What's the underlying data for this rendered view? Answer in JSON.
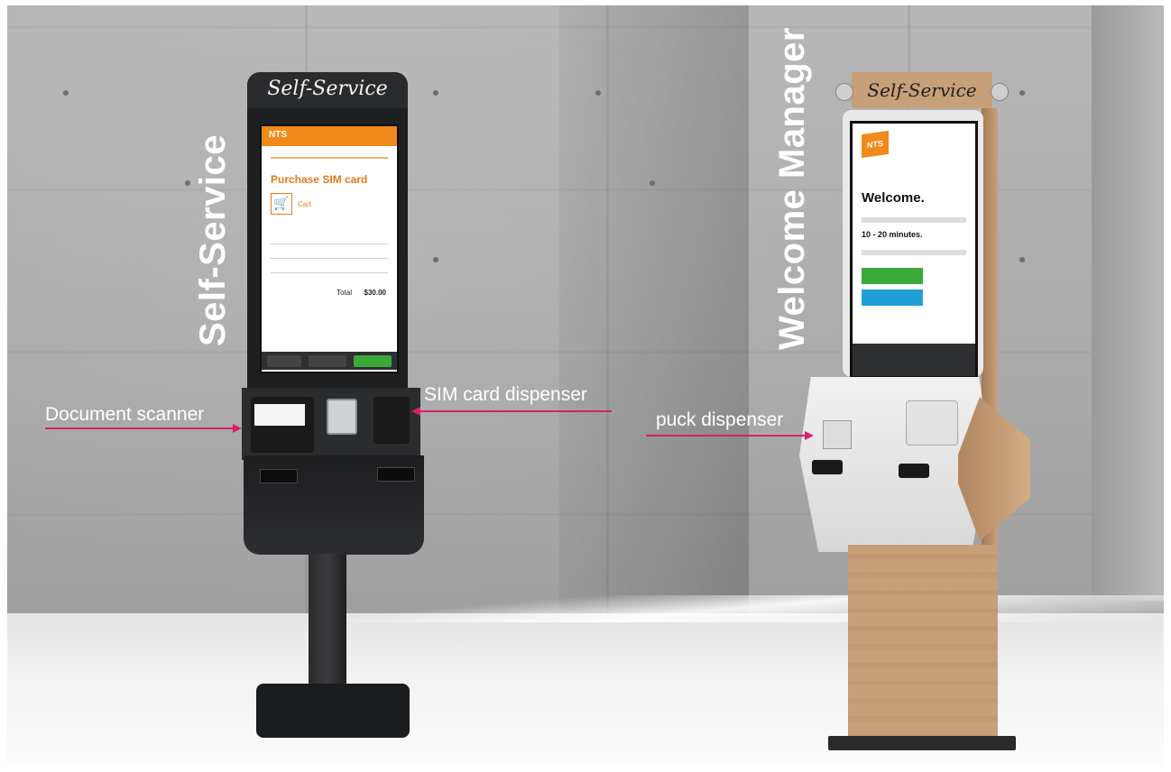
{
  "image": {
    "left_label": "Self-Service",
    "right_label": "Welcome Manager",
    "callouts": {
      "document_scanner": "Document scanner",
      "sim_card_dispenser": "SIM card dispenser",
      "puck_dispenser": "puck dispenser"
    },
    "colors": {
      "callout_arrow": "#d8206a",
      "kiosk_accent": "#f08a1a"
    }
  },
  "left_kiosk": {
    "header_sign": "Self-Service",
    "screen": {
      "brand": "NTS",
      "title": "Purchase SIM card",
      "cart_label": "Cart",
      "total_label": "Total",
      "total_value": "$30.00"
    }
  },
  "right_kiosk": {
    "header_sign": "Self-Service",
    "screen": {
      "logo": "NTS",
      "welcome": "Welcome.",
      "wait_time": "10 - 20 minutes."
    }
  }
}
